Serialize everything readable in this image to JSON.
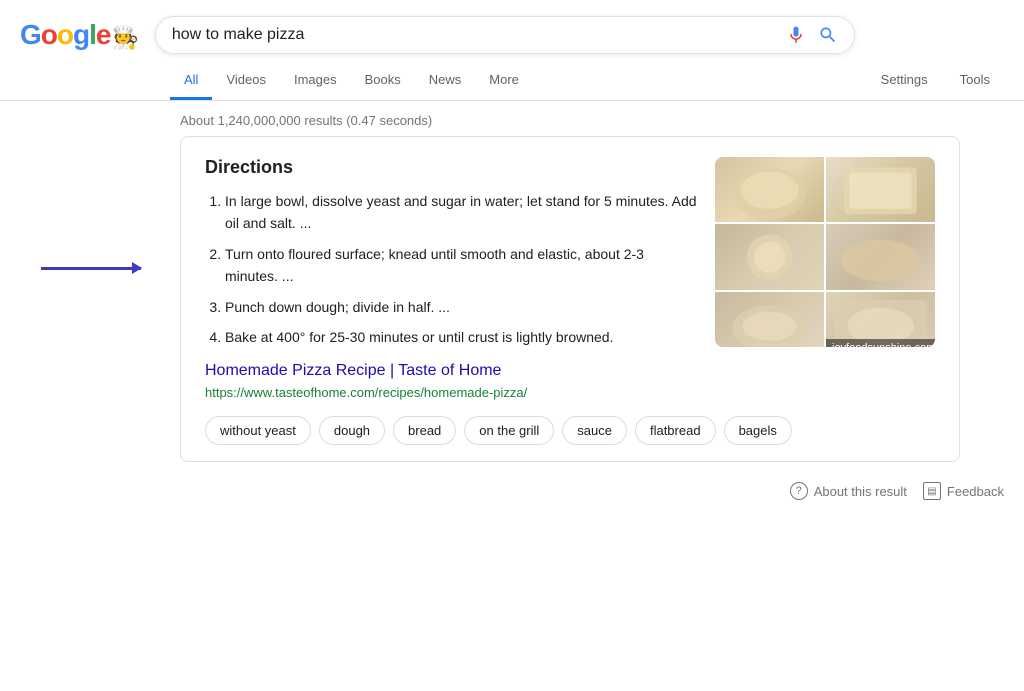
{
  "header": {
    "logo_letters": [
      "G",
      "o",
      "o",
      "g"
    ],
    "logo_l": "l",
    "logo_e": "e",
    "search_value": "how to make pizza",
    "search_placeholder": "Search"
  },
  "nav": {
    "tabs": [
      {
        "label": "All",
        "active": true
      },
      {
        "label": "Videos",
        "active": false
      },
      {
        "label": "Images",
        "active": false
      },
      {
        "label": "Books",
        "active": false
      },
      {
        "label": "News",
        "active": false
      },
      {
        "label": "More",
        "active": false
      }
    ],
    "right_tabs": [
      {
        "label": "Settings"
      },
      {
        "label": "Tools"
      }
    ]
  },
  "results": {
    "count_text": "About 1,240,000,000 results (0.47 seconds)"
  },
  "card": {
    "directions_title": "Directions",
    "steps": [
      "In large bowl, dissolve yeast and sugar in water; let stand for 5 minutes. Add oil and salt. ...",
      "Turn onto floured surface; knead until smooth and elastic, about 2-3 minutes. ...",
      "Punch down dough; divide in half. ...",
      "Bake at 400° for 25-30 minutes or until crust is lightly browned."
    ],
    "image_source": "joyfoodsunshine.com",
    "link_text": "Homemade Pizza Recipe | Taste of Home",
    "link_url": "https://www.tasteofhome.com/recipes/homemade-pizza/",
    "tags": [
      "without yeast",
      "dough",
      "bread",
      "on the grill",
      "sauce",
      "flatbread",
      "bagels"
    ]
  },
  "footer": {
    "about_label": "About this result",
    "feedback_label": "Feedback"
  }
}
